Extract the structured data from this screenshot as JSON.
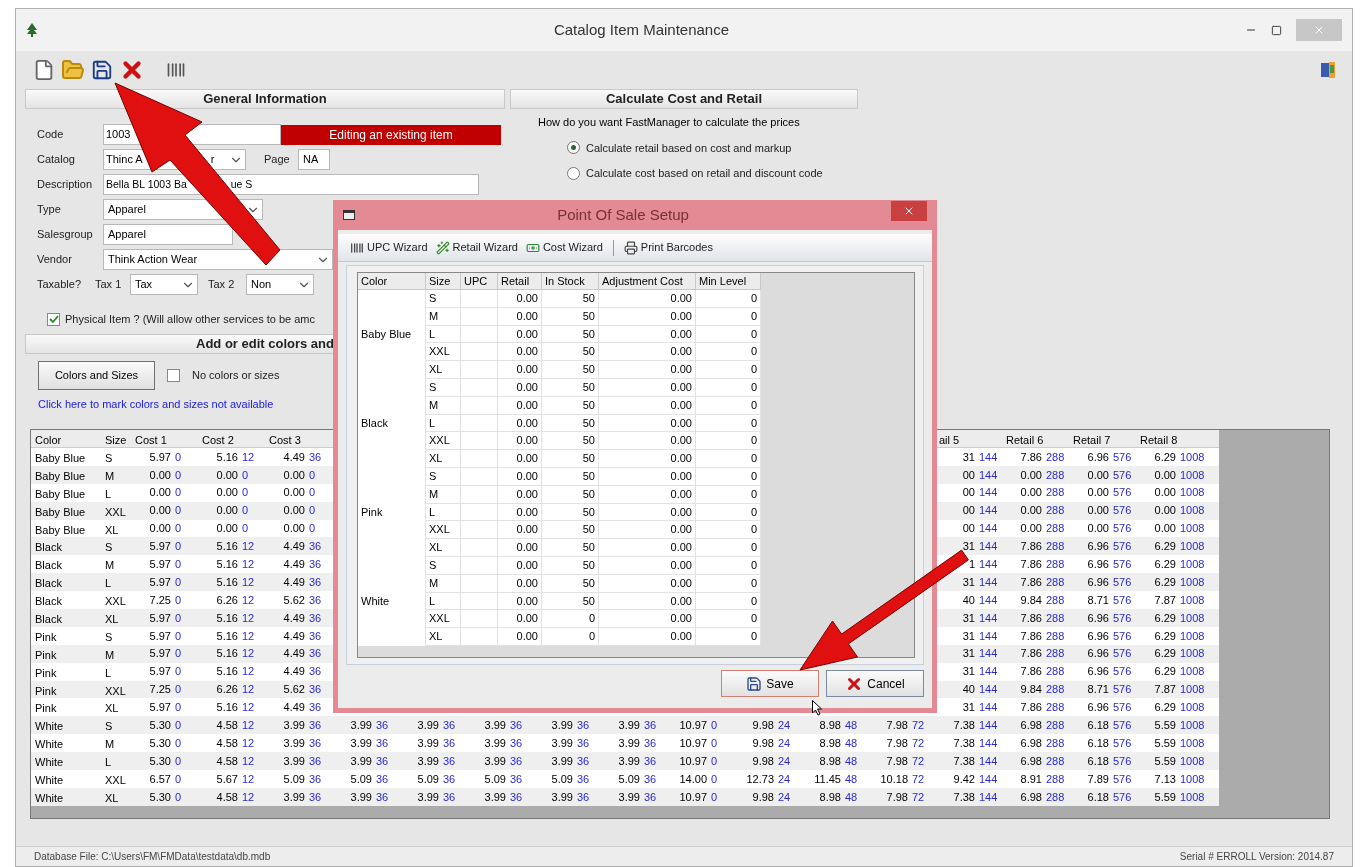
{
  "window": {
    "title": "Catalog Item Maintenance"
  },
  "general": {
    "header": "General Information",
    "code": {
      "label": "Code",
      "value": "1003"
    },
    "status": "Editing an existing item",
    "catalog": {
      "label": "Catalog",
      "value_fragments": [
        "Thinc A",
        "r"
      ]
    },
    "page": {
      "label": "Page",
      "value": "NA"
    },
    "description": {
      "label": "Description",
      "value_fragments": [
        "Bella BL 1003 Ba",
        "ue S"
      ]
    },
    "type": {
      "label": "Type",
      "value": "Apparel"
    },
    "salesgroup": {
      "label": "Salesgroup",
      "value": "Apparel"
    },
    "vendor": {
      "label": "Vendor",
      "value": "Think Action Wear"
    },
    "taxable": {
      "label": "Taxable?",
      "tax1": {
        "label": "Tax 1",
        "value": "Tax"
      },
      "tax2": {
        "label": "Tax 2",
        "value": "Non"
      }
    },
    "physical": {
      "label": "Physical Item ? (Will allow other services to be amc",
      "checked": true
    }
  },
  "colors_section": {
    "header": "Add or edit colors and",
    "button": "Colors and Sizes",
    "no_colors": {
      "label": "No colors or sizes",
      "checked": false
    },
    "link": "Click here to mark colors and sizes not available"
  },
  "calculate": {
    "header": "Calculate Cost and Retail",
    "question": "How do you want FastManager to calculate the prices",
    "options": [
      {
        "label": "Calculate retail based on cost and markup",
        "selected": true
      },
      {
        "label": "Calculate cost based on retail and discount code",
        "selected": false
      }
    ]
  },
  "grid": {
    "columns": [
      "Color",
      "Size",
      "Cost 1",
      "Cost 2",
      "Cost 3",
      null,
      null,
      null,
      null,
      null,
      null,
      null,
      null,
      null,
      "ail 5",
      "Retail 6",
      "Retail 7",
      "Retail 8"
    ],
    "rows": [
      {
        "cells": [
          "Baby Blue",
          "S",
          [
            "5.97",
            "0"
          ],
          [
            "5.16",
            "12"
          ],
          [
            "4.49",
            "36"
          ],
          null,
          null,
          null,
          null,
          null,
          null,
          null,
          null,
          null,
          [
            "31",
            "144"
          ],
          [
            "7.86",
            "288"
          ],
          [
            "6.96",
            "576"
          ],
          [
            "6.29",
            "1008"
          ]
        ]
      },
      {
        "cells": [
          "Baby Blue",
          "M",
          [
            "0.00",
            "0"
          ],
          [
            "0.00",
            "0"
          ],
          [
            "0.00",
            "0"
          ],
          null,
          null,
          null,
          null,
          null,
          null,
          null,
          null,
          null,
          [
            "00",
            "144"
          ],
          [
            "0.00",
            "288"
          ],
          [
            "0.00",
            "576"
          ],
          [
            "0.00",
            "1008"
          ]
        ]
      },
      {
        "cells": [
          "Baby Blue",
          "L",
          [
            "0.00",
            "0"
          ],
          [
            "0.00",
            "0"
          ],
          [
            "0.00",
            "0"
          ],
          null,
          null,
          null,
          null,
          null,
          null,
          null,
          null,
          null,
          [
            "00",
            "144"
          ],
          [
            "0.00",
            "288"
          ],
          [
            "0.00",
            "576"
          ],
          [
            "0.00",
            "1008"
          ]
        ]
      },
      {
        "cells": [
          "Baby Blue",
          "XXL",
          [
            "0.00",
            "0"
          ],
          [
            "0.00",
            "0"
          ],
          [
            "0.00",
            "0"
          ],
          null,
          null,
          null,
          null,
          null,
          null,
          null,
          null,
          null,
          [
            "00",
            "144"
          ],
          [
            "0.00",
            "288"
          ],
          [
            "0.00",
            "576"
          ],
          [
            "0.00",
            "1008"
          ]
        ]
      },
      {
        "cells": [
          "Baby Blue",
          "XL",
          [
            "0.00",
            "0"
          ],
          [
            "0.00",
            "0"
          ],
          [
            "0.00",
            "0"
          ],
          null,
          null,
          null,
          null,
          null,
          null,
          null,
          null,
          null,
          [
            "00",
            "144"
          ],
          [
            "0.00",
            "288"
          ],
          [
            "0.00",
            "576"
          ],
          [
            "0.00",
            "1008"
          ]
        ]
      },
      {
        "cells": [
          "Black",
          "S",
          [
            "5.97",
            "0"
          ],
          [
            "5.16",
            "12"
          ],
          [
            "4.49",
            "36"
          ],
          null,
          null,
          null,
          null,
          null,
          null,
          null,
          null,
          null,
          [
            "31",
            "144"
          ],
          [
            "7.86",
            "288"
          ],
          [
            "6.96",
            "576"
          ],
          [
            "6.29",
            "1008"
          ]
        ]
      },
      {
        "cells": [
          "Black",
          "M",
          [
            "5.97",
            "0"
          ],
          [
            "5.16",
            "12"
          ],
          [
            "4.49",
            "36"
          ],
          null,
          null,
          null,
          null,
          null,
          null,
          null,
          null,
          null,
          [
            "1",
            "144"
          ],
          [
            "7.86",
            "288"
          ],
          [
            "6.96",
            "576"
          ],
          [
            "6.29",
            "1008"
          ]
        ]
      },
      {
        "cells": [
          "Black",
          "L",
          [
            "5.97",
            "0"
          ],
          [
            "5.16",
            "12"
          ],
          [
            "4.49",
            "36"
          ],
          null,
          null,
          null,
          null,
          null,
          null,
          null,
          null,
          null,
          [
            "31",
            "144"
          ],
          [
            "7.86",
            "288"
          ],
          [
            "6.96",
            "576"
          ],
          [
            "6.29",
            "1008"
          ]
        ]
      },
      {
        "cells": [
          "Black",
          "XXL",
          [
            "7.25",
            "0"
          ],
          [
            "6.26",
            "12"
          ],
          [
            "5.62",
            "36"
          ],
          null,
          null,
          null,
          null,
          null,
          null,
          null,
          null,
          null,
          [
            "40",
            "144"
          ],
          [
            "9.84",
            "288"
          ],
          [
            "8.71",
            "576"
          ],
          [
            "7.87",
            "1008"
          ]
        ]
      },
      {
        "cells": [
          "Black",
          "XL",
          [
            "5.97",
            "0"
          ],
          [
            "5.16",
            "12"
          ],
          [
            "4.49",
            "36"
          ],
          null,
          null,
          null,
          null,
          null,
          null,
          null,
          null,
          null,
          [
            "31",
            "144"
          ],
          [
            "7.86",
            "288"
          ],
          [
            "6.96",
            "576"
          ],
          [
            "6.29",
            "1008"
          ]
        ]
      },
      {
        "cells": [
          "Pink",
          "S",
          [
            "5.97",
            "0"
          ],
          [
            "5.16",
            "12"
          ],
          [
            "4.49",
            "36"
          ],
          null,
          null,
          null,
          null,
          null,
          null,
          null,
          null,
          null,
          [
            "31",
            "144"
          ],
          [
            "7.86",
            "288"
          ],
          [
            "6.96",
            "576"
          ],
          [
            "6.29",
            "1008"
          ]
        ]
      },
      {
        "cells": [
          "Pink",
          "M",
          [
            "5.97",
            "0"
          ],
          [
            "5.16",
            "12"
          ],
          [
            "4.49",
            "36"
          ],
          null,
          null,
          null,
          null,
          null,
          null,
          null,
          null,
          null,
          [
            "31",
            "144"
          ],
          [
            "7.86",
            "288"
          ],
          [
            "6.96",
            "576"
          ],
          [
            "6.29",
            "1008"
          ]
        ]
      },
      {
        "cells": [
          "Pink",
          "L",
          [
            "5.97",
            "0"
          ],
          [
            "5.16",
            "12"
          ],
          [
            "4.49",
            "36"
          ],
          null,
          null,
          null,
          null,
          null,
          null,
          null,
          null,
          null,
          [
            "31",
            "144"
          ],
          [
            "7.86",
            "288"
          ],
          [
            "6.96",
            "576"
          ],
          [
            "6.29",
            "1008"
          ]
        ]
      },
      {
        "cells": [
          "Pink",
          "XXL",
          [
            "7.25",
            "0"
          ],
          [
            "6.26",
            "12"
          ],
          [
            "5.62",
            "36"
          ],
          null,
          null,
          null,
          null,
          null,
          null,
          null,
          null,
          null,
          [
            "40",
            "144"
          ],
          [
            "9.84",
            "288"
          ],
          [
            "8.71",
            "576"
          ],
          [
            "7.87",
            "1008"
          ]
        ]
      },
      {
        "cells": [
          "Pink",
          "XL",
          [
            "5.97",
            "0"
          ],
          [
            "5.16",
            "12"
          ],
          [
            "4.49",
            "36"
          ],
          null,
          null,
          null,
          null,
          null,
          null,
          null,
          null,
          null,
          [
            "31",
            "144"
          ],
          [
            "7.86",
            "288"
          ],
          [
            "6.96",
            "576"
          ],
          [
            "6.29",
            "1008"
          ]
        ]
      },
      {
        "cells": [
          "White",
          "S",
          [
            "5.30",
            "0"
          ],
          [
            "4.58",
            "12"
          ],
          [
            "3.99",
            "36"
          ],
          [
            "3.99",
            "36"
          ],
          [
            "3.99",
            "36"
          ],
          [
            "3.99",
            "36"
          ],
          [
            "3.99",
            "36"
          ],
          [
            "3.99",
            "36"
          ],
          [
            "10.97",
            "0"
          ],
          [
            "9.98",
            "24"
          ],
          [
            "8.98",
            "48"
          ],
          [
            "7.98",
            "72"
          ],
          [
            "7.38",
            "144"
          ],
          [
            "6.98",
            "288"
          ],
          [
            "6.18",
            "576"
          ],
          [
            "5.59",
            "1008"
          ]
        ]
      },
      {
        "cells": [
          "White",
          "M",
          [
            "5.30",
            "0"
          ],
          [
            "4.58",
            "12"
          ],
          [
            "3.99",
            "36"
          ],
          [
            "3.99",
            "36"
          ],
          [
            "3.99",
            "36"
          ],
          [
            "3.99",
            "36"
          ],
          [
            "3.99",
            "36"
          ],
          [
            "3.99",
            "36"
          ],
          [
            "10.97",
            "0"
          ],
          [
            "9.98",
            "24"
          ],
          [
            "8.98",
            "48"
          ],
          [
            "7.98",
            "72"
          ],
          [
            "7.38",
            "144"
          ],
          [
            "6.98",
            "288"
          ],
          [
            "6.18",
            "576"
          ],
          [
            "5.59",
            "1008"
          ]
        ]
      },
      {
        "cells": [
          "White",
          "L",
          [
            "5.30",
            "0"
          ],
          [
            "4.58",
            "12"
          ],
          [
            "3.99",
            "36"
          ],
          [
            "3.99",
            "36"
          ],
          [
            "3.99",
            "36"
          ],
          [
            "3.99",
            "36"
          ],
          [
            "3.99",
            "36"
          ],
          [
            "3.99",
            "36"
          ],
          [
            "10.97",
            "0"
          ],
          [
            "9.98",
            "24"
          ],
          [
            "8.98",
            "48"
          ],
          [
            "7.98",
            "72"
          ],
          [
            "7.38",
            "144"
          ],
          [
            "6.98",
            "288"
          ],
          [
            "6.18",
            "576"
          ],
          [
            "5.59",
            "1008"
          ]
        ]
      },
      {
        "cells": [
          "White",
          "XXL",
          [
            "6.57",
            "0"
          ],
          [
            "5.67",
            "12"
          ],
          [
            "5.09",
            "36"
          ],
          [
            "5.09",
            "36"
          ],
          [
            "5.09",
            "36"
          ],
          [
            "5.09",
            "36"
          ],
          [
            "5.09",
            "36"
          ],
          [
            "5.09",
            "36"
          ],
          [
            "14.00",
            "0"
          ],
          [
            "12.73",
            "24"
          ],
          [
            "11.45",
            "48"
          ],
          [
            "10.18",
            "72"
          ],
          [
            "9.42",
            "144"
          ],
          [
            "8.91",
            "288"
          ],
          [
            "7.89",
            "576"
          ],
          [
            "7.13",
            "1008"
          ]
        ]
      },
      {
        "cells": [
          "White",
          "XL",
          [
            "5.30",
            "0"
          ],
          [
            "4.58",
            "12"
          ],
          [
            "3.99",
            "36"
          ],
          [
            "3.99",
            "36"
          ],
          [
            "3.99",
            "36"
          ],
          [
            "3.99",
            "36"
          ],
          [
            "3.99",
            "36"
          ],
          [
            "3.99",
            "36"
          ],
          [
            "10.97",
            "0"
          ],
          [
            "9.98",
            "24"
          ],
          [
            "8.98",
            "48"
          ],
          [
            "7.98",
            "72"
          ],
          [
            "7.38",
            "144"
          ],
          [
            "6.98",
            "288"
          ],
          [
            "6.18",
            "576"
          ],
          [
            "5.59",
            "1008"
          ]
        ]
      }
    ]
  },
  "status_bar": {
    "left": "Database File: C:\\Users\\FM\\FMData\\testdata\\db.mdb",
    "right": "Serial # ERROLL  Version: 2014.87"
  },
  "dialog": {
    "title": "Point Of Sale Setup",
    "toolbar": [
      {
        "kind": "upc",
        "label": "UPC Wizard"
      },
      {
        "kind": "retail",
        "label": "Retail Wizard"
      },
      {
        "kind": "cost",
        "label": "Cost Wizard"
      },
      {
        "kind": "print",
        "label": "Print Barcodes"
      }
    ],
    "columns": [
      "Color",
      "Size",
      "UPC",
      "Retail",
      "In Stock",
      "Adjustment Cost",
      "Min Level"
    ],
    "groups": [
      {
        "color_name": "Baby Blue",
        "rows": [
          {
            "size": "S",
            "retail": "0.00",
            "in_stock": "50",
            "adjustment_cost": "0.00",
            "min_level": "0"
          },
          {
            "size": "M",
            "retail": "0.00",
            "in_stock": "50",
            "adjustment_cost": "0.00",
            "min_level": "0"
          },
          {
            "size": "L",
            "retail": "0.00",
            "in_stock": "50",
            "adjustment_cost": "0.00",
            "min_level": "0"
          },
          {
            "size": "XXL",
            "retail": "0.00",
            "in_stock": "50",
            "adjustment_cost": "0.00",
            "min_level": "0"
          },
          {
            "size": "XL",
            "retail": "0.00",
            "in_stock": "50",
            "adjustment_cost": "0.00",
            "min_level": "0"
          }
        ]
      },
      {
        "color_name": "Black",
        "rows": [
          {
            "size": "S",
            "retail": "0.00",
            "in_stock": "50",
            "adjustment_cost": "0.00",
            "min_level": "0"
          },
          {
            "size": "M",
            "retail": "0.00",
            "in_stock": "50",
            "adjustment_cost": "0.00",
            "min_level": "0"
          },
          {
            "size": "L",
            "retail": "0.00",
            "in_stock": "50",
            "adjustment_cost": "0.00",
            "min_level": "0"
          },
          {
            "size": "XXL",
            "retail": "0.00",
            "in_stock": "50",
            "adjustment_cost": "0.00",
            "min_level": "0"
          },
          {
            "size": "XL",
            "retail": "0.00",
            "in_stock": "50",
            "adjustment_cost": "0.00",
            "min_level": "0"
          }
        ]
      },
      {
        "color_name": "Pink",
        "rows": [
          {
            "size": "S",
            "retail": "0.00",
            "in_stock": "50",
            "adjustment_cost": "0.00",
            "min_level": "0"
          },
          {
            "size": "M",
            "retail": "0.00",
            "in_stock": "50",
            "adjustment_cost": "0.00",
            "min_level": "0"
          },
          {
            "size": "L",
            "retail": "0.00",
            "in_stock": "50",
            "adjustment_cost": "0.00",
            "min_level": "0"
          },
          {
            "size": "XXL",
            "retail": "0.00",
            "in_stock": "50",
            "adjustment_cost": "0.00",
            "min_level": "0"
          },
          {
            "size": "XL",
            "retail": "0.00",
            "in_stock": "50",
            "adjustment_cost": "0.00",
            "min_level": "0"
          }
        ]
      },
      {
        "color_name": "White",
        "rows": [
          {
            "size": "S",
            "retail": "0.00",
            "in_stock": "50",
            "adjustment_cost": "0.00",
            "min_level": "0"
          },
          {
            "size": "M",
            "retail": "0.00",
            "in_stock": "50",
            "adjustment_cost": "0.00",
            "min_level": "0"
          },
          {
            "size": "L",
            "retail": "0.00",
            "in_stock": "50",
            "adjustment_cost": "0.00",
            "min_level": "0"
          },
          {
            "size": "XXL",
            "retail": "0.00",
            "in_stock": "0",
            "adjustment_cost": "0.00",
            "min_level": "0"
          },
          {
            "size": "XL",
            "retail": "0.00",
            "in_stock": "0",
            "adjustment_cost": "0.00",
            "min_level": "0"
          }
        ]
      }
    ],
    "buttons": [
      {
        "kind": "save",
        "label": "Save"
      },
      {
        "kind": "cancel",
        "label": "Cancel"
      }
    ]
  }
}
